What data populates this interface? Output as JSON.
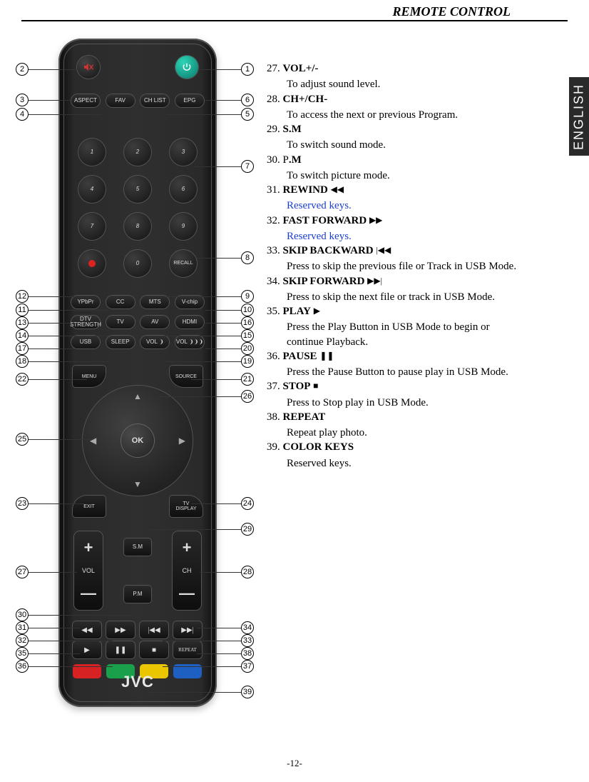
{
  "header": "REMOTE CONTROL",
  "language_tab": "ENGLISH",
  "page_number": "-12-",
  "brand": "JVC",
  "remote": {
    "power": "⏻",
    "mute": "🔇",
    "aspect": "ASPECT",
    "fav": "FAV",
    "chlist": "CH LIST",
    "epg": "EPG",
    "num1": "1",
    "num2": "2",
    "num3": "3",
    "num4": "4",
    "num5": "5",
    "num6": "6",
    "num7": "7",
    "num8": "8",
    "num9": "9",
    "num0": "0",
    "recall": "RECALL",
    "ypbpr": "YPbPr",
    "cc": "CC",
    "mts": "MTS",
    "vchip": "V-chip",
    "dtv": "DTV\nSTRENGTH",
    "tv": "TV",
    "av": "AV",
    "hdmi": "HDMI",
    "usb": "USB",
    "sleep": "SLEEP",
    "volminus": "VOL",
    "volplus": "VOL",
    "menu": "MENU",
    "source": "SOURCE",
    "exit": "EXIT",
    "tvdisp": "TV\nDISPLAY",
    "ok": "OK",
    "vol_label": "VOL",
    "ch_label": "CH",
    "sm": "S.M",
    "pm": "P.M",
    "repeat": "REPEAT",
    "plus": "+",
    "minus": "—"
  },
  "callouts": {
    "c1": "1",
    "c2": "2",
    "c3": "3",
    "c4": "4",
    "c5": "5",
    "c6": "6",
    "c7": "7",
    "c8": "8",
    "c9": "9",
    "c10": "10",
    "c11": "11",
    "c12": "12",
    "c13": "13",
    "c14": "14",
    "c15": "15",
    "c16": "16",
    "c17": "17",
    "c18": "18",
    "c19": "19",
    "c20": "20",
    "c21": "21",
    "c22": "22",
    "c23": "23",
    "c24": "24",
    "c25": "25",
    "c26": "26",
    "c27": "27",
    "c28": "28",
    "c29": "29",
    "c30": "30",
    "c31": "31",
    "c32": "32",
    "c33": "33",
    "c34": "34",
    "c35": "35",
    "c36": "36",
    "c37": "37",
    "c38": "38",
    "c39": "39"
  },
  "desc": {
    "i27_t": "27. ",
    "i27_b": "VOL+/-",
    "i27_s": "To adjust sound level.",
    "i28_t": "28. ",
    "i28_b": "CH+/CH-",
    "i28_s": "To access the next or previous Program.",
    "i29_t": "29. ",
    "i29_b": "S.M",
    "i29_s": "To switch sound mode.",
    "i30_t": "30. P",
    "i30_b": ".M",
    "i30_s": "To switch picture mode.",
    "i31_t": "31. ",
    "i31_b": "REWIND",
    "i31_s": "Reserved keys.",
    "i32_t": "32. ",
    "i32_b": "FAST FORWARD",
    "i32_s": "Reserved keys.",
    "i33_t": "33. ",
    "i33_b": "SKIP BACKWARD",
    "i33_s": "Press to skip the previous file or Track in USB Mode.",
    "i34_t": "34. ",
    "i34_b": "SKIP FORWARD",
    "i34_s": "Press to skip the next file or track in USB Mode.",
    "i35_t": "35. ",
    "i35_b": "PLAY",
    "i35_s": "Press the Play Button in USB Mode to begin or",
    "i35_s2": " continue Playback.",
    "i36_t": "36. ",
    "i36_b": "PAUSE",
    "i36_s": "Press the Pause Button to pause play in USB Mode.",
    "i37_t": "37. ",
    "i37_b": "STOP",
    "i37_s": " Press to Stop play in USB Mode.",
    "i38_t": "38. ",
    "i38_b": "REPEAT",
    "i38_s": " Repeat play photo.",
    "i39_t": "39. ",
    "i39_b": "COLOR KEYS",
    "i39_s": " Reserved  keys."
  }
}
